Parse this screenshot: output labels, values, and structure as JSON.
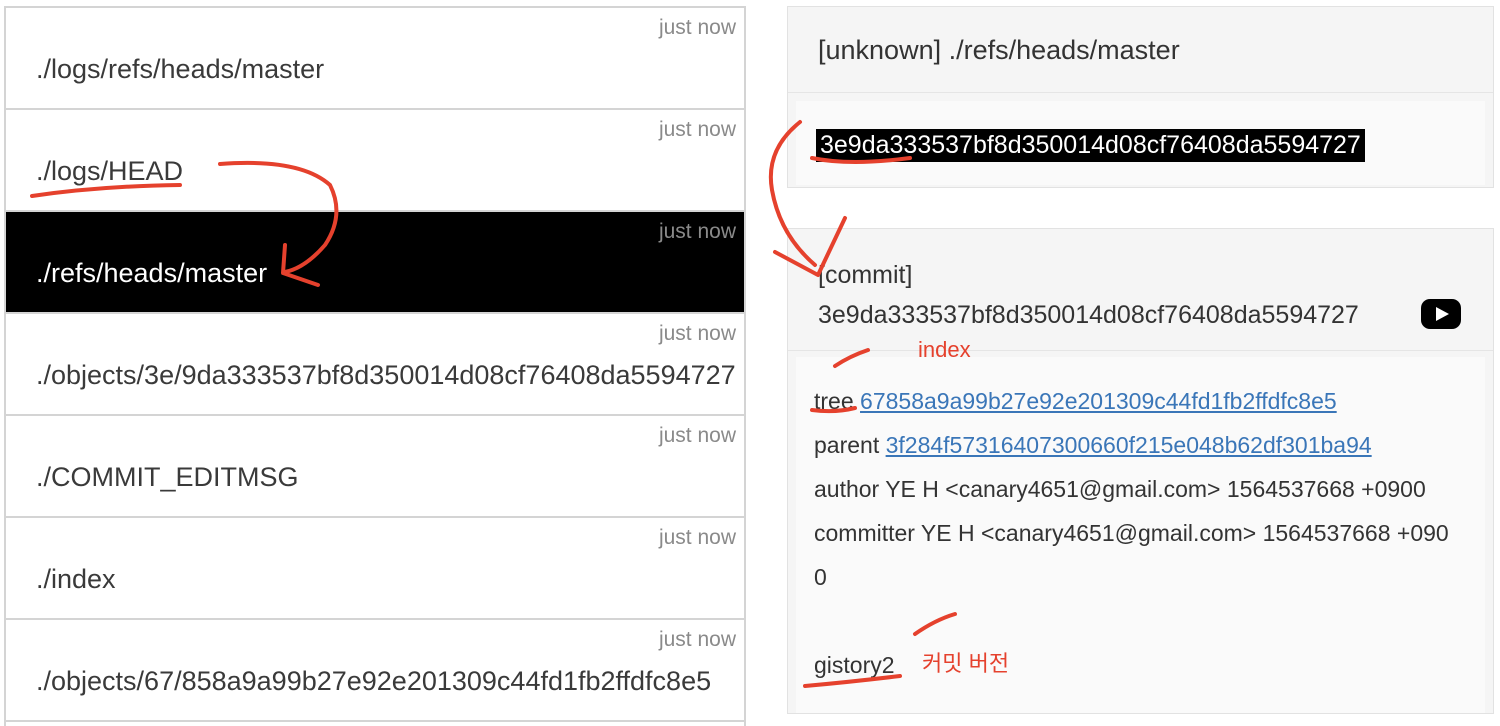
{
  "files": [
    {
      "path": "./logs/refs/heads/master",
      "time": "just now",
      "selected": false
    },
    {
      "path": "./logs/HEAD",
      "time": "just now",
      "selected": false
    },
    {
      "path": "./refs/heads/master",
      "time": "just now",
      "selected": true
    },
    {
      "path": "./objects/3e/9da333537bf8d350014d08cf76408da5594727",
      "time": "just now",
      "selected": false
    },
    {
      "path": "./COMMIT_EDITMSG",
      "time": "just now",
      "selected": false
    },
    {
      "path": "./index",
      "time": "just now",
      "selected": false
    },
    {
      "path": "./objects/67/858a9a99b27e92e201309c44fd1fb2ffdfc8e5",
      "time": "just now",
      "selected": false
    }
  ],
  "ref_panel": {
    "title": "[unknown] ./refs/heads/master",
    "hash": "3e9da333537bf8d350014d08cf76408da5594727"
  },
  "commit_panel": {
    "type_label": "[commit]",
    "hash": "3e9da333537bf8d350014d08cf76408da5594727",
    "tree_label": "tree",
    "tree_hash": "67858a9a99b27e92e201309c44fd1fb2ffdfc8e5",
    "parent_label": "parent",
    "parent_hash": "3f284f57316407300660f215e048b62df301ba94",
    "author": "author YE H <canary4651@gmail.com> 1564537668 +0900",
    "committer_line1": "committer YE H <canary4651@gmail.com> 1564537668 +090",
    "committer_line2": "0",
    "message": "gistory2"
  },
  "annotations": {
    "index_note": "index",
    "commit_version_note": "커밋 버전"
  },
  "colors": {
    "annotation": "#e5412d",
    "link": "#3a76b8",
    "selected_bg": "#000000"
  },
  "icons": {
    "play": "play-icon"
  }
}
